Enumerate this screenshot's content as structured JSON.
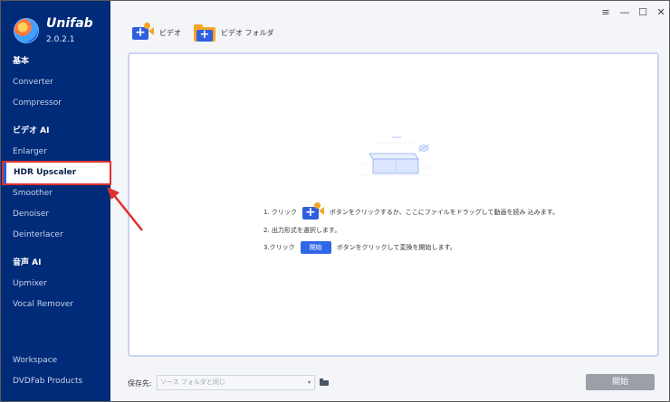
{
  "app": {
    "name": "Unifab",
    "version": "2.0.2.1"
  },
  "sidebar": {
    "sections": [
      {
        "title": "基本",
        "items": [
          "Converter",
          "Compressor"
        ]
      },
      {
        "title": "ビデオ AI",
        "items": [
          "Enlarger",
          "HDR Upscaler",
          "Smoother",
          "Denoiser",
          "Deinterlacer"
        ]
      },
      {
        "title": "音声 AI",
        "items": [
          "Upmixer",
          "Vocal Remover"
        ]
      }
    ],
    "active_item": "HDR Upscaler",
    "bottom_items": [
      "Workspace",
      "DVDFab Products"
    ]
  },
  "window_controls": {
    "menu": "≡",
    "minimize": "—",
    "maximize": "☐",
    "close": "✕"
  },
  "toolbar": {
    "add_video_label": "ビデオ",
    "add_folder_label": "ビデオ フォルダ"
  },
  "instructions": {
    "step1_pre": "1. クリック",
    "step1_post": "ボタンをクリックするか、ここにファイルをドラッグして動画を読み 込みます。",
    "step2": "2. 出力形式を選択します。",
    "step3_pre": "3.クリック",
    "step3_button": "開始",
    "step3_post": "ボタンをクリックして変換を開始します。"
  },
  "bottom_bar": {
    "save_label": "保存先:",
    "save_value": "ソース フォルダと同じ",
    "dropdown_arrow": "▾",
    "start_label": "開始"
  },
  "colors": {
    "sidebar_bg": "#002b78",
    "accent": "#2f67e8",
    "highlight_red": "#e0312f",
    "start_disabled": "#9a9fa8"
  }
}
